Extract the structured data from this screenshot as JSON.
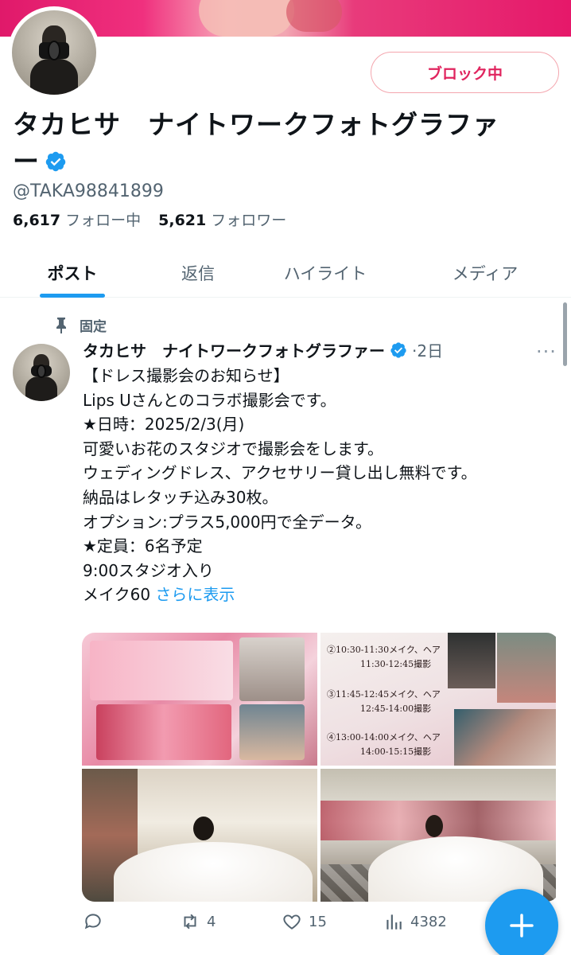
{
  "profile": {
    "name_line1": "タカヒサ　ナイトワークフォトグラファ",
    "name_line2": "ー",
    "handle": "@TAKA98841899",
    "following_count": "6,617",
    "following_label": "フォロー中",
    "followers_count": "5,621",
    "followers_label": "フォロワー",
    "block_button_label": "ブロック中"
  },
  "tabs": [
    {
      "label": "ポスト",
      "active": true
    },
    {
      "label": "返信",
      "active": false
    },
    {
      "label": "ハイライト",
      "active": false
    },
    {
      "label": "メディア",
      "active": false
    }
  ],
  "post": {
    "pinned_label": "固定",
    "author": "タカヒサ　ナイトワークフォトグラファー",
    "time": "·2日",
    "more": "···",
    "lines": [
      "【ドレス撮影会のお知らせ】",
      "Lips Uさんとのコラボ撮影会です。",
      "★日時：2025/2/3(月)",
      "可愛いお花のスタジオで撮影会をします。",
      "ウェディングドレス、アクセサリー貸し出し無料です。",
      "納品はレタッチ込み30枚。",
      "オプション:プラス5,000円で全データ。",
      "★定員：6名予定",
      "9:00スタジオ入り"
    ],
    "last_line_text": "メイク60 ",
    "show_more": "さらに表示",
    "schedule": [
      "②10:30-11:30メイク、ヘア",
      "11:30-12:45撮影",
      "③11:45-12:45メイク、ヘア",
      "12:45-14:00撮影",
      "④13:00-14:00メイク、ヘア",
      "14:00-15:15撮影"
    ],
    "stats": {
      "replies": "",
      "reposts": "4",
      "likes": "15",
      "views": "4382"
    }
  },
  "colors": {
    "accent": "#1d9bf0",
    "block_red": "#e0245e",
    "secondary_text": "#536471"
  }
}
